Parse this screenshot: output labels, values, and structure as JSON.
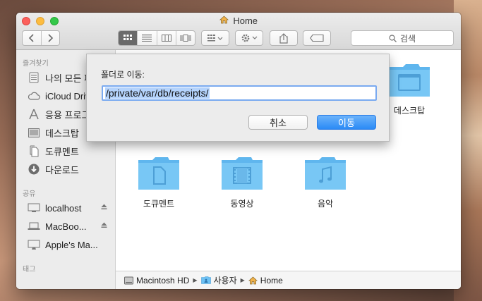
{
  "window": {
    "title": "Home"
  },
  "toolbar": {
    "search_placeholder": "검색",
    "icons": [
      "back-icon",
      "forward-icon",
      "icon-view-icon",
      "list-view-icon",
      "column-view-icon",
      "cover-flow-icon",
      "arrange-icon",
      "action-gear-icon",
      "share-icon",
      "tag-icon",
      "search-icon"
    ]
  },
  "sidebar": {
    "favorites_heading": "즐겨찾기",
    "favorites": [
      {
        "label": "나의 모든 파일",
        "icon": "all-files-icon"
      },
      {
        "label": "iCloud Drive",
        "icon": "icloud-icon"
      },
      {
        "label": "응용 프로그램",
        "icon": "applications-icon"
      },
      {
        "label": "데스크탑",
        "icon": "desktop-icon"
      },
      {
        "label": "도큐멘트",
        "icon": "documents-icon"
      },
      {
        "label": "다운로드",
        "icon": "downloads-icon"
      }
    ],
    "shared_heading": "공유",
    "shared": [
      {
        "label": "localhost",
        "icon": "computer-icon"
      },
      {
        "label": "MacBoo...",
        "icon": "laptop-icon"
      },
      {
        "label": "Apple's Ma...",
        "icon": "imac-icon"
      }
    ],
    "tags_heading": "태그"
  },
  "content": {
    "folders": [
      {
        "label": "데스크탑",
        "icon": "desktop-folder-icon"
      },
      {
        "label": "도큐멘트",
        "icon": "documents-folder-icon"
      },
      {
        "label": "동영상",
        "icon": "movies-folder-icon"
      },
      {
        "label": "음악",
        "icon": "music-folder-icon"
      }
    ]
  },
  "pathbar": {
    "items": [
      {
        "label": "Macintosh HD",
        "icon": "hard-drive-icon"
      },
      {
        "label": "사용자",
        "icon": "users-folder-icon"
      },
      {
        "label": "Home",
        "icon": "home-icon"
      }
    ]
  },
  "goto_sheet": {
    "label": "폴더로 이동:",
    "path_value": "/private/var/db/receipts/",
    "cancel_label": "취소",
    "go_label": "이동"
  },
  "colors": {
    "folder_blue": "#6ec2f5",
    "primary_button": "#2a8af6",
    "selection": "#b4d3fc"
  }
}
